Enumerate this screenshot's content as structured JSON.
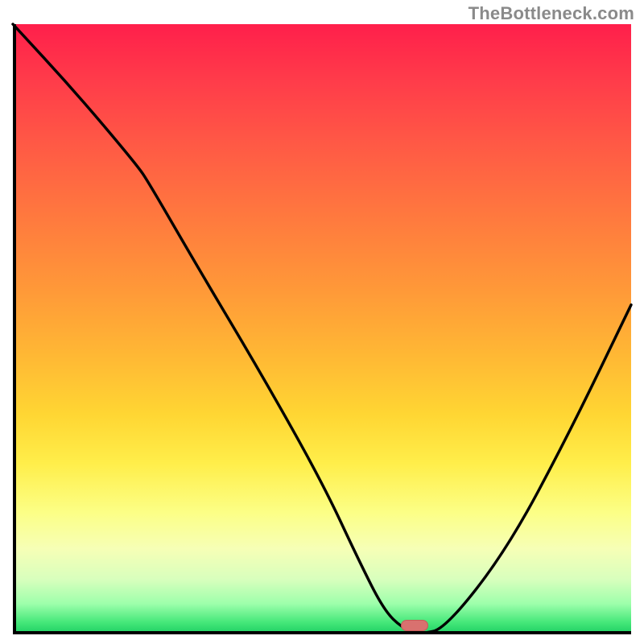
{
  "watermark": "TheBottleneck.com",
  "chart_data": {
    "type": "line",
    "title": "",
    "xlabel": "",
    "ylabel": "",
    "xlim": [
      0,
      100
    ],
    "ylim": [
      0,
      100
    ],
    "grid": false,
    "series": [
      {
        "name": "bottleneck-curve",
        "x": [
          0,
          10,
          20,
          22,
          30,
          40,
          50,
          56,
          60,
          63,
          66,
          70,
          80,
          90,
          100
        ],
        "y": [
          100,
          89,
          77,
          74,
          60,
          43,
          25,
          12,
          4,
          1,
          0,
          1,
          14,
          33,
          54
        ]
      }
    ],
    "annotations": [
      {
        "name": "optimal-marker",
        "x": 65,
        "y": 0,
        "shape": "pill",
        "color": "#d9716f"
      }
    ],
    "background": {
      "type": "vertical-gradient",
      "stops": [
        {
          "pos": 0.0,
          "color": "#ff1f4b"
        },
        {
          "pos": 0.32,
          "color": "#ff7a3e"
        },
        {
          "pos": 0.64,
          "color": "#ffd633"
        },
        {
          "pos": 0.86,
          "color": "#f6ffb6"
        },
        {
          "pos": 1.0,
          "color": "#1cce62"
        }
      ]
    }
  },
  "marker_color": "#d9716f"
}
